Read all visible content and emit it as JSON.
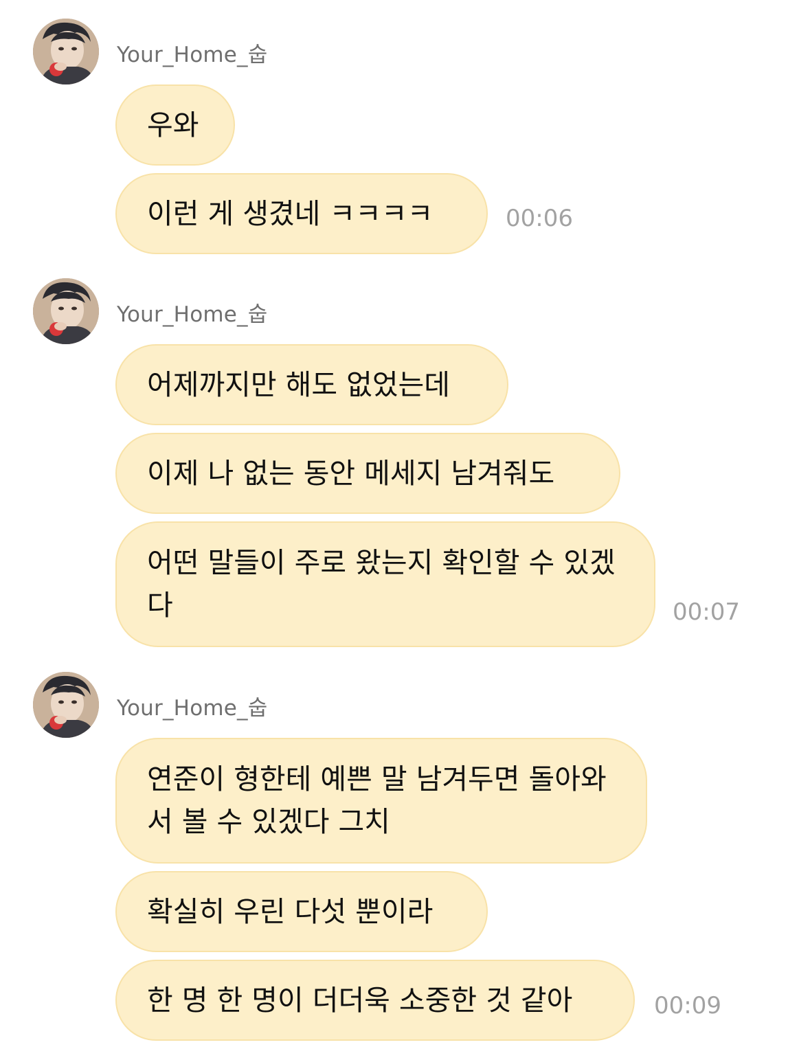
{
  "groups": [
    {
      "sender": "Your_Home_숩",
      "messages": [
        "우와",
        "이런 게 생겼네 ㅋㅋㅋㅋ"
      ],
      "time": "00:06"
    },
    {
      "sender": "Your_Home_숩",
      "messages": [
        "어제까지만 해도 없었는데",
        "이제 나 없는 동안 메세지 남겨줘도",
        "어떤 말들이 주로 왔는지 확인할 수 있겠다"
      ],
      "time": "00:07"
    },
    {
      "sender": "Your_Home_숩",
      "messages": [
        "연준이 형한테 예쁜 말 남겨두면 돌아와서 볼 수 있겠다 그치",
        "확실히 우린 다섯 뿐이라",
        "한 명 한 명이 더더욱 소중한 것 같아"
      ],
      "time": "00:09"
    }
  ],
  "colors": {
    "bubble_bg": "#fdefc9",
    "bubble_border": "#f8e2a8",
    "sender_text": "#6f6f6f",
    "time_text": "#a2a2a2"
  },
  "icons": {
    "avatar": "profile-photo"
  }
}
